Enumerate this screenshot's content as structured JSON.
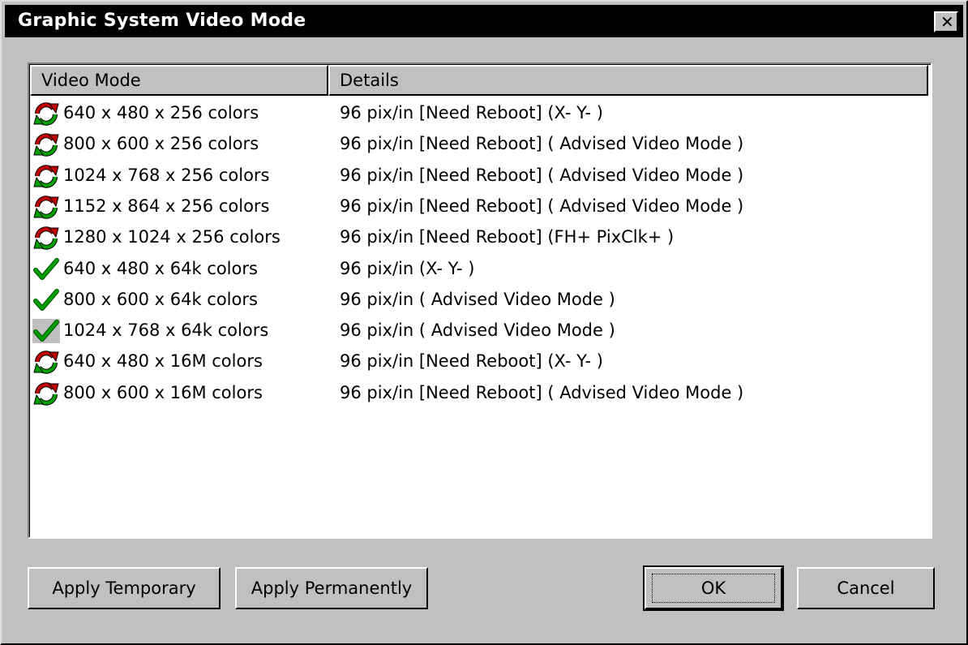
{
  "window": {
    "title": "Graphic System Video Mode",
    "close_label": "✕"
  },
  "list": {
    "columns": [
      "Video Mode",
      "Details"
    ],
    "rows": [
      {
        "icon": "refresh-reboot-icon",
        "mode": "640 x 480 x 256 colors",
        "details": "96 pix/in [Need Reboot] (X- Y- )",
        "selected": false
      },
      {
        "icon": "refresh-reboot-icon",
        "mode": "800 x 600 x 256 colors",
        "details": "96 pix/in [Need Reboot] ( Advised Video Mode )",
        "selected": false
      },
      {
        "icon": "refresh-reboot-icon",
        "mode": "1024 x 768 x 256 colors",
        "details": "96 pix/in [Need Reboot] ( Advised Video Mode )",
        "selected": false
      },
      {
        "icon": "refresh-reboot-icon",
        "mode": "1152 x 864 x 256 colors",
        "details": "96 pix/in [Need Reboot] ( Advised Video Mode )",
        "selected": false
      },
      {
        "icon": "refresh-reboot-icon",
        "mode": "1280 x 1024 x 256 colors",
        "details": "96 pix/in [Need Reboot] (FH+ PixClk+ )",
        "selected": false
      },
      {
        "icon": "checkmark-icon",
        "mode": "640 x 480 x 64k colors",
        "details": "96 pix/in (X- Y- )",
        "selected": false
      },
      {
        "icon": "checkmark-icon",
        "mode": "800 x 600 x 64k colors",
        "details": "96 pix/in ( Advised Video Mode )",
        "selected": false
      },
      {
        "icon": "checkmark-icon",
        "mode": "1024 x 768 x 64k colors",
        "details": "96 pix/in ( Advised Video Mode )",
        "selected": true
      },
      {
        "icon": "refresh-reboot-icon",
        "mode": "640 x 480 x 16M colors",
        "details": "96 pix/in [Need Reboot] (X- Y- )",
        "selected": false
      },
      {
        "icon": "refresh-reboot-icon",
        "mode": "800 x 600 x 16M colors",
        "details": "96 pix/in [Need Reboot] ( Advised Video Mode )",
        "selected": false
      }
    ]
  },
  "buttons": {
    "apply_temporary": "Apply Temporary",
    "apply_permanently": "Apply Permanently",
    "ok": "OK",
    "cancel": "Cancel"
  },
  "colors": {
    "face": "#c0c0c0",
    "titlebar": "#000000",
    "check_green": "#00a000",
    "arrow_red": "#c00000",
    "arrow_green": "#00a000"
  }
}
